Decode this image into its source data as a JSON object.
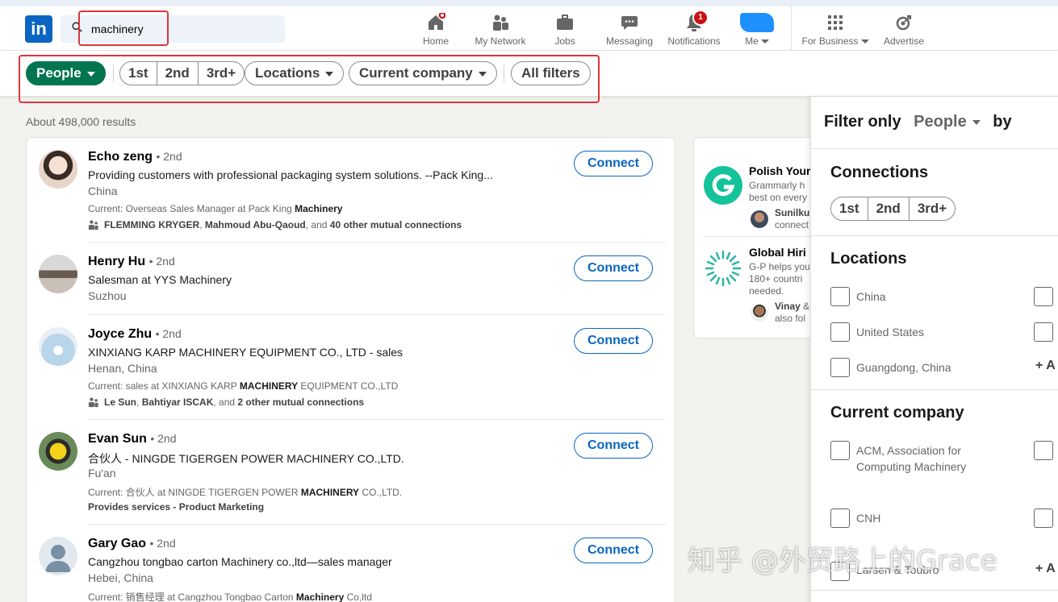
{
  "nav": {
    "logo_text": "in",
    "search_value": "machinery",
    "items": [
      {
        "label": "Home",
        "icon": "home-icon"
      },
      {
        "label": "My Network",
        "icon": "network-icon"
      },
      {
        "label": "Jobs",
        "icon": "briefcase-icon"
      },
      {
        "label": "Messaging",
        "icon": "messaging-icon"
      },
      {
        "label": "Notifications",
        "icon": "bell-icon",
        "badge": "1"
      },
      {
        "label": "Me",
        "icon": "avatar"
      },
      {
        "label": "For Business",
        "icon": "grid-icon"
      },
      {
        "label": "Advertise",
        "icon": "advertise-icon"
      }
    ]
  },
  "filters": {
    "people": "People",
    "degrees": [
      "1st",
      "2nd",
      "3rd+"
    ],
    "locations": "Locations",
    "current_company": "Current company",
    "all_filters": "All filters"
  },
  "results_count": "About 498,000 results",
  "results": [
    {
      "name": "Echo zeng",
      "degree": "• 2nd",
      "headline": "Providing customers with professional packaging system solutions. --Pack King...",
      "location": "China",
      "current_prefix": "Current: Overseas Sales Manager at Pack King ",
      "current_bold": "Machinery",
      "current_suffix": "",
      "mutual_bold_1": "FLEMMING KRYGER",
      "mutual_sep": ", ",
      "mutual_bold_2": "Mahmoud Abu-Qaoud",
      "mutual_mid": ", and ",
      "mutual_bold_3": "40 other mutual connections",
      "connect": "Connect"
    },
    {
      "name": "Henry Hu",
      "degree": "• 2nd",
      "headline": "Salesman at YYS Machinery",
      "location": "Suzhou",
      "connect": "Connect"
    },
    {
      "name": "Joyce Zhu",
      "degree": "• 2nd",
      "headline": "XINXIANG KARP MACHINERY EQUIPMENT CO., LTD - sales",
      "location": "Henan, China",
      "current_prefix": "Current: sales at XINXIANG KARP ",
      "current_bold": "MACHINERY",
      "current_suffix": " EQUIPMENT CO.,LTD",
      "mutual_bold_1": "Le Sun",
      "mutual_sep": ", ",
      "mutual_bold_2": "Bahtiyar ISCAK",
      "mutual_mid": ", and ",
      "mutual_bold_3": "2 other mutual connections",
      "connect": "Connect"
    },
    {
      "name": "Evan Sun",
      "degree": "• 2nd",
      "headline": "合伙人 - NINGDE TIGERGEN POWER MACHINERY CO.,LTD.",
      "location": "Fu'an",
      "current_prefix": "Current: 合伙人 at NINGDE TIGERGEN POWER ",
      "current_bold": "MACHINERY",
      "current_suffix": " CO.,LTD.",
      "services": "Provides services - Product Marketing",
      "connect": "Connect"
    },
    {
      "name": "Gary Gao",
      "degree": "• 2nd",
      "headline": "Cangzhou tongbao carton Machinery co.,ltd—sales manager",
      "location": "Hebei, China",
      "current_prefix": "Current: 销售经理 at Cangzhou Tongbao Carton ",
      "current_bold": "Machinery",
      "current_suffix": " Co,ltd",
      "connect": "Connect"
    }
  ],
  "ads": [
    {
      "title": "Polish Your",
      "line1": "Grammarly h",
      "line2": "best on every",
      "person": "Sunilku",
      "person_sub": "connect",
      "logo": "grammarly-logo",
      "color": "#15c39a"
    },
    {
      "title": "Global Hiri",
      "line1": "G-P helps you",
      "line2": "180+ countri",
      "line3": "needed.",
      "person": "Vinay",
      "person_rest": " &",
      "person_sub": "also fol",
      "logo": "gp-logo",
      "color": "#2bb5a0"
    }
  ],
  "panel": {
    "filter_only": "Filter only",
    "dropdown": "People",
    "by": "by",
    "connections_title": "Connections",
    "degrees": [
      "1st",
      "2nd",
      "3rd+"
    ],
    "locations_title": "Locations",
    "locations": [
      "China",
      "United States",
      "Guangdong, China"
    ],
    "locations_add": "+ A",
    "company_title": "Current company",
    "companies": [
      "ACM, Association for",
      "Computing Machinery",
      "CNH",
      "Larsen & Toubro"
    ],
    "company_add": "+ A"
  },
  "watermark": "知乎 @外贸路上的Grace",
  "colors": {
    "brand": "#0a66c2",
    "green": "#01754f",
    "highlight": "#d9363e"
  }
}
